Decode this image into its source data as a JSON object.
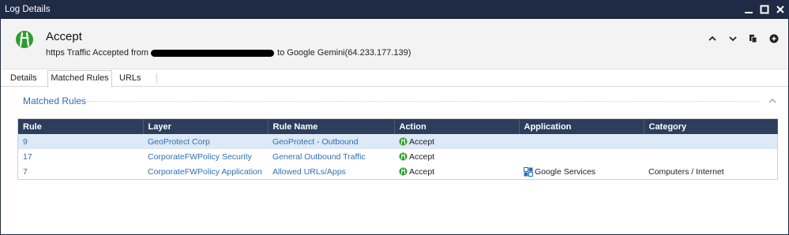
{
  "window": {
    "title": "Log Details"
  },
  "header": {
    "action_title": "Accept",
    "summary_prefix": "https Traffic Accepted from",
    "summary_suffix": "to Google Gemini(64.233.177.139)"
  },
  "tabs": [
    {
      "label": "Details"
    },
    {
      "label": "Matched Rules"
    },
    {
      "label": "URLs"
    }
  ],
  "section": {
    "title": "Matched Rules"
  },
  "table": {
    "columns": [
      "Rule",
      "Layer",
      "Rule Name",
      "Action",
      "Application",
      "Category"
    ],
    "rows": [
      {
        "rule": "9",
        "layer": "GeoProtect Corp",
        "rule_name": "GeoProtect - Outbound",
        "action": "Accept",
        "application": "",
        "category": ""
      },
      {
        "rule": "17",
        "layer": "CorporateFWPolicy Security",
        "rule_name": "General Outbound Traffic",
        "action": "Accept",
        "application": "",
        "category": ""
      },
      {
        "rule": "7",
        "layer": "CorporateFWPolicy Application",
        "rule_name": "Allowed URLs/Apps",
        "action": "Accept",
        "application": "Google Services",
        "category": "Computers / Internet"
      }
    ]
  },
  "colors": {
    "titlebar": "#1f2a44",
    "accept_green": "#2e9e2e",
    "link_blue": "#2f6fb5",
    "grid_header": "#2c3e5c",
    "selected_row": "#dde9f6"
  },
  "icons": {
    "accept": "accept-icon",
    "minimize": "minimize-icon",
    "maximize": "maximize-icon",
    "close": "close-icon",
    "prev": "chevron-up-icon",
    "next": "chevron-down-icon",
    "copy": "copy-icon",
    "more": "more-icon",
    "application": "application-icon"
  }
}
